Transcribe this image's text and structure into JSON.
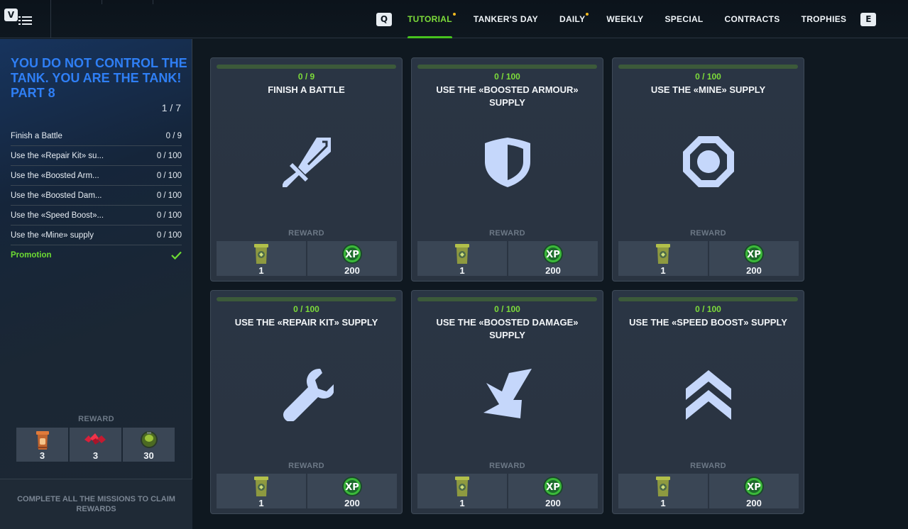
{
  "header": {
    "menu_key": "V",
    "prev_key": "Q",
    "next_key": "E",
    "tabs": [
      {
        "label": "TUTORIAL",
        "active": true,
        "notify": true
      },
      {
        "label": "TANKER'S DAY",
        "active": false,
        "notify": false
      },
      {
        "label": "DAILY",
        "active": false,
        "notify": true
      },
      {
        "label": "WEEKLY",
        "active": false,
        "notify": false
      },
      {
        "label": "SPECIAL",
        "active": false,
        "notify": false
      },
      {
        "label": "CONTRACTS",
        "active": false,
        "notify": false
      },
      {
        "label": "TROPHIES",
        "active": false,
        "notify": false
      }
    ]
  },
  "sidebar": {
    "title": "YOU DO NOT CONTROL THE TANK. YOU ARE THE TANK! PART 8",
    "progress": "1 / 7",
    "tasks": [
      {
        "name": "Finish a Battle",
        "value": "0 / 9"
      },
      {
        "name": "Use the «Repair Kit» su...",
        "value": "0 / 100"
      },
      {
        "name": "Use the «Boosted Arm...",
        "value": "0 / 100"
      },
      {
        "name": "Use the «Boosted Dam...",
        "value": "0 / 100"
      },
      {
        "name": "Use the «Speed Boost»...",
        "value": "0 / 100"
      },
      {
        "name": "Use the «Mine» supply",
        "value": "0 / 100"
      },
      {
        "name": "Promotion",
        "value": "",
        "done": true
      }
    ],
    "reward_label": "REWARD",
    "rewards": [
      {
        "icon": "container-icon",
        "count": "3"
      },
      {
        "icon": "crystals-icon",
        "count": "3"
      },
      {
        "icon": "battery-icon",
        "count": "30"
      }
    ],
    "claim_text": "COMPLETE ALL THE MISSIONS TO CLAIM REWARDS"
  },
  "cards": [
    {
      "progress": "0 / 9",
      "title": "FINISH A BATTLE",
      "icon": "sword-icon",
      "reward_label": "REWARD",
      "rewards": [
        "1",
        "200"
      ]
    },
    {
      "progress": "0 / 100",
      "title": "USE THE «BOOSTED ARMOUR» SUPPLY",
      "icon": "shield-icon",
      "reward_label": "REWARD",
      "rewards": [
        "1",
        "200"
      ]
    },
    {
      "progress": "0 / 100",
      "title": "USE THE «MINE» SUPPLY",
      "icon": "mine-icon",
      "reward_label": "REWARD",
      "rewards": [
        "1",
        "200"
      ]
    },
    {
      "progress": "0 / 100",
      "title": "USE THE «REPAIR KIT» SUPPLY",
      "icon": "wrench-icon",
      "reward_label": "REWARD",
      "rewards": [
        "1",
        "200"
      ]
    },
    {
      "progress": "0 / 100",
      "title": "USE THE «BOOSTED DAMAGE» SUPPLY",
      "icon": "lightning-icon",
      "reward_label": "REWARD",
      "rewards": [
        "1",
        "200"
      ]
    },
    {
      "progress": "0 / 100",
      "title": "USE THE «SPEED BOOST» SUPPLY",
      "icon": "chevrons-up-icon",
      "reward_label": "REWARD",
      "rewards": [
        "1",
        "200"
      ]
    }
  ],
  "colors": {
    "accent_green": "#7ddc3a",
    "title_blue": "#2f7ff5",
    "icon_blue": "#c5d7fb",
    "notify_dot": "#f0b820"
  }
}
